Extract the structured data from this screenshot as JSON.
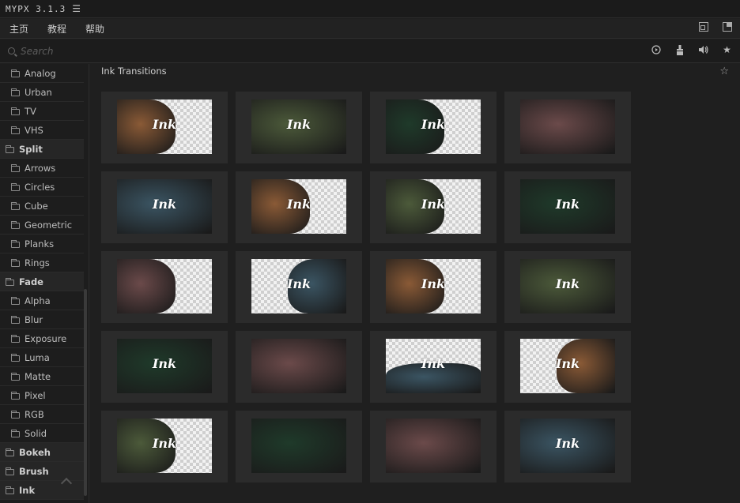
{
  "app": {
    "title": "MYPX 3.1.3"
  },
  "menu": [
    "主页",
    "教程",
    "帮助"
  ],
  "search": {
    "placeholder": "Search"
  },
  "sidebar": {
    "items": [
      {
        "label": "Analog",
        "type": "child"
      },
      {
        "label": "Urban",
        "type": "child"
      },
      {
        "label": "TV",
        "type": "child"
      },
      {
        "label": "VHS",
        "type": "child"
      },
      {
        "label": "Split",
        "type": "parent"
      },
      {
        "label": "Arrows",
        "type": "child"
      },
      {
        "label": "Circles",
        "type": "child"
      },
      {
        "label": "Cube",
        "type": "child"
      },
      {
        "label": "Geometric",
        "type": "child"
      },
      {
        "label": "Planks",
        "type": "child"
      },
      {
        "label": "Rings",
        "type": "child"
      },
      {
        "label": "Fade",
        "type": "parent"
      },
      {
        "label": "Alpha",
        "type": "child"
      },
      {
        "label": "Blur",
        "type": "child"
      },
      {
        "label": "Exposure",
        "type": "child"
      },
      {
        "label": "Luma",
        "type": "child"
      },
      {
        "label": "Matte",
        "type": "child"
      },
      {
        "label": "Pixel",
        "type": "child"
      },
      {
        "label": "RGB",
        "type": "child"
      },
      {
        "label": "Solid",
        "type": "child"
      },
      {
        "label": "Bokeh",
        "type": "parent"
      },
      {
        "label": "Brush",
        "type": "parent"
      },
      {
        "label": "Ink",
        "type": "parent"
      }
    ]
  },
  "main": {
    "title": "Ink Transitions",
    "tiles": [
      {
        "scene": "coffee",
        "side": "left",
        "ink": "Ink"
      },
      {
        "scene": "couple",
        "side": "full",
        "ink": "Ink"
      },
      {
        "scene": "forest",
        "side": "left",
        "ink": "Ink"
      },
      {
        "scene": "mug",
        "side": "full",
        "ink": ""
      },
      {
        "scene": "sea",
        "side": "full",
        "ink": "Ink"
      },
      {
        "scene": "coffee",
        "side": "left",
        "ink": "Ink"
      },
      {
        "scene": "couple",
        "side": "left",
        "ink": "Ink"
      },
      {
        "scene": "forest",
        "side": "full",
        "ink": "Ink"
      },
      {
        "scene": "mug",
        "side": "left",
        "ink": ""
      },
      {
        "scene": "sea",
        "side": "right",
        "ink": "Ink"
      },
      {
        "scene": "coffee",
        "side": "left",
        "ink": "Ink"
      },
      {
        "scene": "couple",
        "side": "full",
        "ink": "Ink"
      },
      {
        "scene": "forest",
        "side": "full",
        "ink": "Ink"
      },
      {
        "scene": "mug",
        "side": "full",
        "ink": ""
      },
      {
        "scene": "sea",
        "side": "bottom",
        "ink": "Ink"
      },
      {
        "scene": "coffee",
        "side": "right",
        "ink": "Ink"
      },
      {
        "scene": "couple",
        "side": "left",
        "ink": "Ink"
      },
      {
        "scene": "forest",
        "side": "full",
        "ink": ""
      },
      {
        "scene": "mug",
        "side": "full",
        "ink": ""
      },
      {
        "scene": "sea",
        "side": "full",
        "ink": "Ink"
      }
    ]
  },
  "colors": {
    "coffee": "#8a5a36",
    "couple": "#4c5a3a",
    "forest": "#1f3a2a",
    "mug": "#6b4a4a",
    "sea": "#3b5563"
  }
}
